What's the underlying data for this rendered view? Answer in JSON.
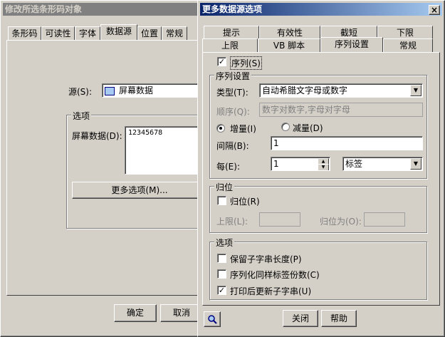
{
  "back_dialog": {
    "title": "修改所选条形码对象",
    "tabs": [
      "条形码",
      "可读性",
      "字体",
      "数据源",
      "位置",
      "常规"
    ],
    "source_label": "源(S):",
    "source_value": "屏幕数据",
    "options_group": "选项",
    "screen_data_label": "屏幕数据(D):",
    "screen_data_value": "12345678",
    "more_options_button": "更多选项(M)...",
    "ok_button": "确定",
    "cancel_button": "取消"
  },
  "front_dialog": {
    "title": "更多数据源选项",
    "close_glyph": "×",
    "tabs_back": [
      "提示",
      "有效性",
      "截短",
      "下限"
    ],
    "tabs_front": [
      "上限",
      "VB 脚本",
      "序列设置",
      "常规"
    ],
    "serial_checkbox": {
      "label": "序列(S)",
      "checked": true
    },
    "serial_group": "序列设置",
    "type_label": "类型(T):",
    "type_value": "自动希腊文字母或数字",
    "order_label": "顺序(Q):",
    "order_value": "数字对数字,字母对字母",
    "increment_label": "增量(I)",
    "decrement_label": "减量(D)",
    "interval_label": "间隔(B):",
    "interval_value": "1",
    "every_label": "每(E):",
    "every_value": "1",
    "every_unit": "标签",
    "reset_group": "归位",
    "reset_checkbox": {
      "label": "归位(R)",
      "checked": false
    },
    "upper_label": "上限(L):",
    "reset_to_label": "归位为(O):",
    "options_group": "选项",
    "option_keep_length": {
      "label": "保留子字串长度(P)",
      "checked": false
    },
    "option_serialize_copies": {
      "label": "序列化同样标签份数(C)",
      "checked": false
    },
    "option_update_after_print": {
      "label": "打印后更新子字串(U)",
      "checked": true
    },
    "close_button": "关闭",
    "help_button": "帮助"
  }
}
